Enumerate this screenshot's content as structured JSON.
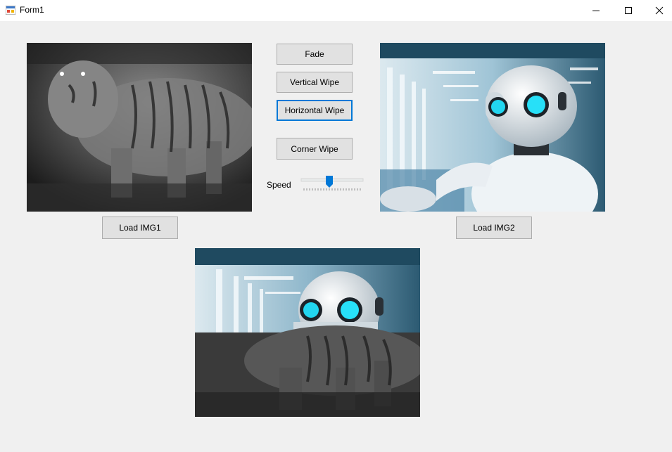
{
  "window": {
    "title": "Form1",
    "icon": "form-app-icon",
    "controls": {
      "minimize": "minimize-icon",
      "maximize": "maximize-icon",
      "close": "close-icon"
    }
  },
  "buttons": {
    "fade": "Fade",
    "vertical_wipe": "Vertical Wipe",
    "horizontal_wipe": "Horizontal Wipe",
    "corner_wipe": "Corner Wipe",
    "load_img1": "Load IMG1",
    "load_img2": "Load IMG2"
  },
  "speed": {
    "label": "Speed",
    "value_fraction": 0.45
  },
  "images": {
    "img1": "tiger-night-photo",
    "img2": "robot-photo",
    "output": "horizontal-wipe-transition-preview"
  },
  "colors": {
    "accent": "#0078d7",
    "window_bg": "#f0f0f0",
    "button_bg": "#e1e1e1",
    "button_border": "#adadad"
  }
}
